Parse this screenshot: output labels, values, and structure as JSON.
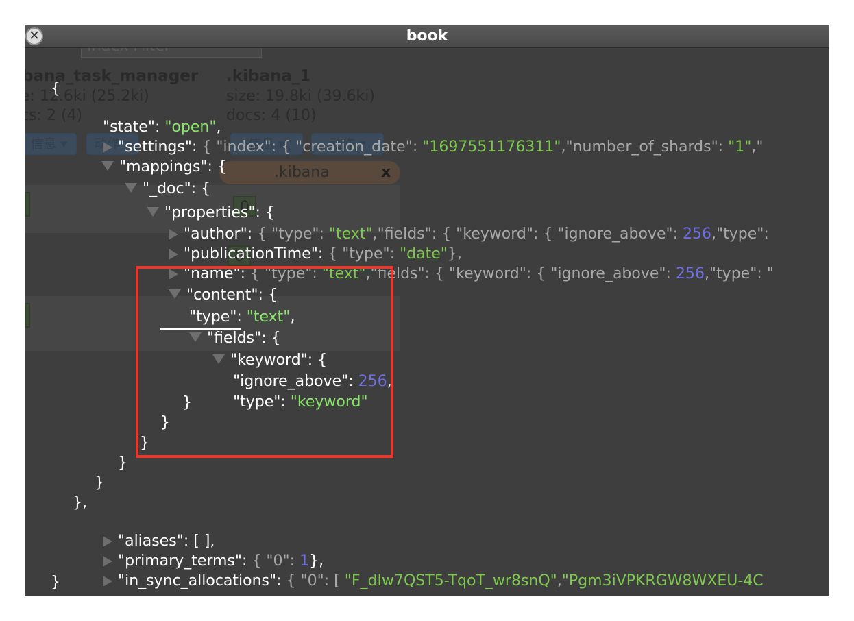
{
  "window": {
    "title": "book"
  },
  "background": {
    "index_filter_placeholder": "Index Filter",
    "cards": [
      {
        "name": "bana_task_manager",
        "size": "e: 12.6ki (25.2ki)",
        "docs": "cs: 2 (4)"
      },
      {
        "name": ".kibana_1",
        "size": "size: 19.8ki (39.6ki)",
        "docs": "docs: 4 (10)"
      }
    ],
    "info_label": "信息 ▾",
    "action_label": "动作 ▾",
    "alias_tab": ".kibana",
    "alias_close": "x",
    "shard_label": "0"
  },
  "json": {
    "open_brace": "{",
    "state_line": {
      "key": "\"state\"",
      "sep": ": ",
      "value": "\"open\"",
      "tail": ","
    },
    "settings_line": {
      "key": "\"settings\"",
      "sep": ": ",
      "p1": "{ \"index\": { \"creation_date\": ",
      "v1": "\"1697551176311\"",
      "p2": ",\"number_of_shards\": ",
      "v2": "\"1\"",
      "p3": ",\""
    },
    "mappings_line": {
      "key": "\"mappings\"",
      "tail": ": {"
    },
    "doc_line": {
      "key": "\"_doc\"",
      "tail": ": {"
    },
    "properties_line": {
      "key": "\"properties\"",
      "tail": ": {"
    },
    "author_line": {
      "key": "\"author\"",
      "sep": ": ",
      "p1": "{ \"type\": ",
      "v1": "\"text\"",
      "p2": ",\"fields\": { \"keyword\": { \"ignore_above\": ",
      "v2": "256",
      "p3": ",\"type\": "
    },
    "publication_line": {
      "key": "\"publicationTime\"",
      "sep": ": ",
      "p1": "{ \"type\": ",
      "v1": "\"date\"",
      "p2": "},"
    },
    "name_line": {
      "key": "\"name\"",
      "sep": ": ",
      "p1": "{ \"type\": ",
      "v1": "\"text\"",
      "p2": ",\"fields\": { \"keyword\": { \"ignore_above\": ",
      "v2": "256",
      "p3": ",\"type\": \""
    },
    "content_line": {
      "key": "\"content\"",
      "tail": ": {"
    },
    "content_type_line": {
      "key": "\"type\"",
      "sep": ": ",
      "value": "\"text\"",
      "tail": ","
    },
    "fields_line": {
      "key": "\"fields\"",
      "tail": ": {"
    },
    "keyword_line": {
      "key": "\"keyword\"",
      "tail": ": {"
    },
    "ignore_line": {
      "key": "\"ignore_above\"",
      "sep": ": ",
      "value": "256",
      "tail": ","
    },
    "kw_type_line": {
      "key": "\"type\"",
      "sep": ": ",
      "value": "\"keyword\""
    },
    "close_brace": "}",
    "close_brace_comma": "},",
    "aliases_line": {
      "key": "\"aliases\"",
      "tail": ": [ ],"
    },
    "primary_terms_line": {
      "key": "\"primary_terms\"",
      "sep": ": ",
      "p1": "{ \"0\": ",
      "v1": "1",
      "p2": "},"
    },
    "in_sync_line": {
      "key": "\"in_sync_allocations\"",
      "sep": ": ",
      "p1": "{ \"0\": [ ",
      "v1": "\"F_dIw7QST5-TqoT_wr8snQ\"",
      "p2": ",",
      "v2": "\"Pgm3iVPKRGW8WXEU-4C"
    }
  },
  "colors": {
    "string": "#7ec850",
    "number": "#6f6fe0",
    "highlight_border": "#e53a2d",
    "background": "#3e3e3e"
  }
}
